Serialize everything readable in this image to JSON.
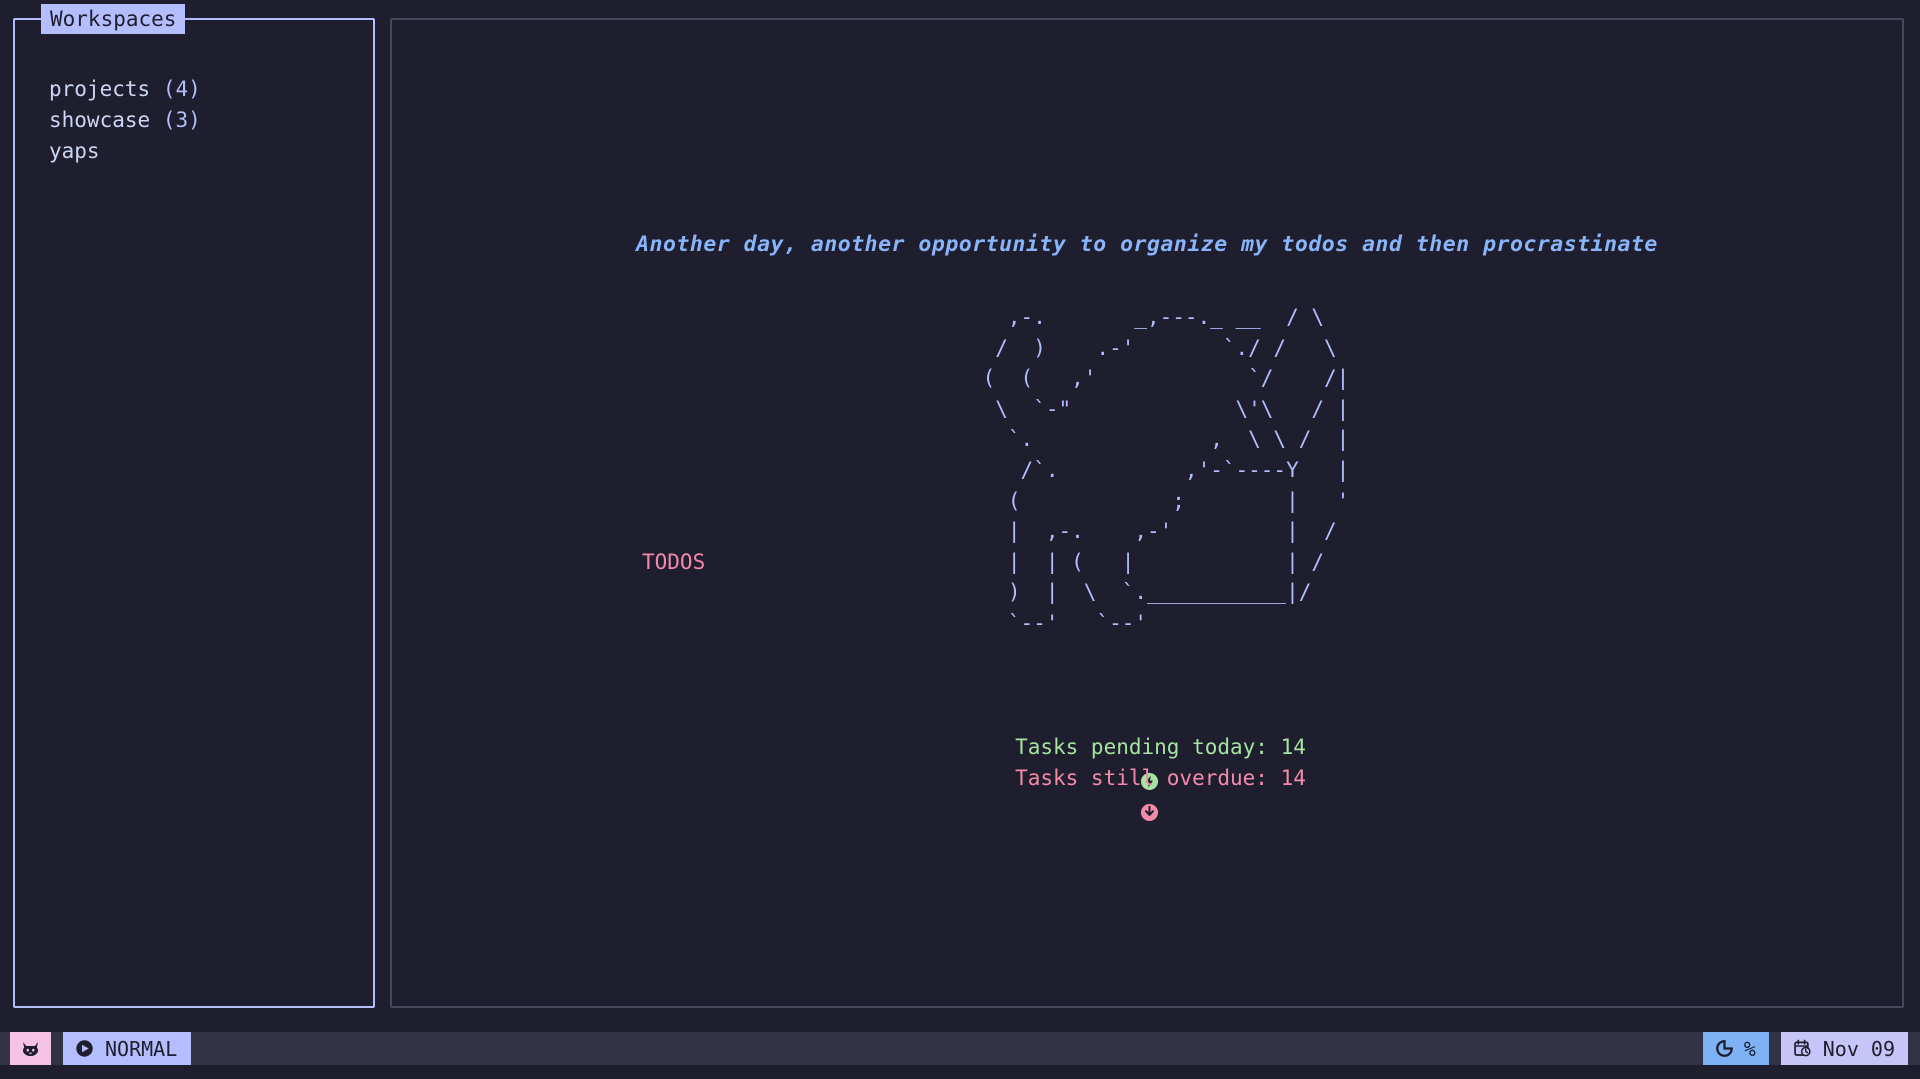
{
  "theme": {
    "background": "#1e1e2e",
    "panel_border_active": "#b4befe",
    "panel_border_inactive": "#45475a",
    "text": "#cdd6f4",
    "accent_lavender": "#b4befe",
    "accent_blue": "#89b4fa",
    "accent_green": "#a6e3a1",
    "accent_pink": "#f38ba8",
    "statusbar_bg": "#313244",
    "logo_badge": "#f5c2e7",
    "progress_badge": "#7eb2f5",
    "date_badge": "#c7c5f8"
  },
  "sidebar": {
    "title": "Workspaces",
    "items": [
      {
        "name": "projects",
        "count": "(4)"
      },
      {
        "name": "showcase",
        "count": "(3)"
      },
      {
        "name": "yaps",
        "count": ""
      }
    ]
  },
  "main": {
    "quote": "Another day, another opportunity to organize my todos and then procrastinate",
    "ascii_art": "     ,-.       _,---._ __  / \\\n    /  )    .-'       `./ /   \\\n   (  (   ,'            `/    /|\n    \\  `-\"             \\'\\   / |\n     `.              ,  \\ \\ /  |\n      /`.          ,'-`----Y   |\n     (            ;        |   '\n     |  ,-.    ,-'         |  /\n     |  | (   |            | /\n     )  |  \\  `.___________|/\n     `--'   `--'",
    "todos_label": "TODOS",
    "stats": [
      {
        "icon": "bolt-circle-icon",
        "label": "Tasks pending today:",
        "value": "14",
        "color": "#a6e3a1",
        "kind": "pending"
      },
      {
        "icon": "arrow-down-circle-icon",
        "label": "Tasks still overdue:",
        "value": "14",
        "color": "#f38ba8",
        "kind": "overdue"
      }
    ]
  },
  "statusbar": {
    "logo_icon": "cat-face-icon",
    "mode_icon": "play-circle-icon",
    "mode_label": "NORMAL",
    "progress_icon": "donut-chart-icon",
    "progress_label": "%",
    "date_icon": "calendar-clock-icon",
    "date_label": "Nov 09"
  }
}
